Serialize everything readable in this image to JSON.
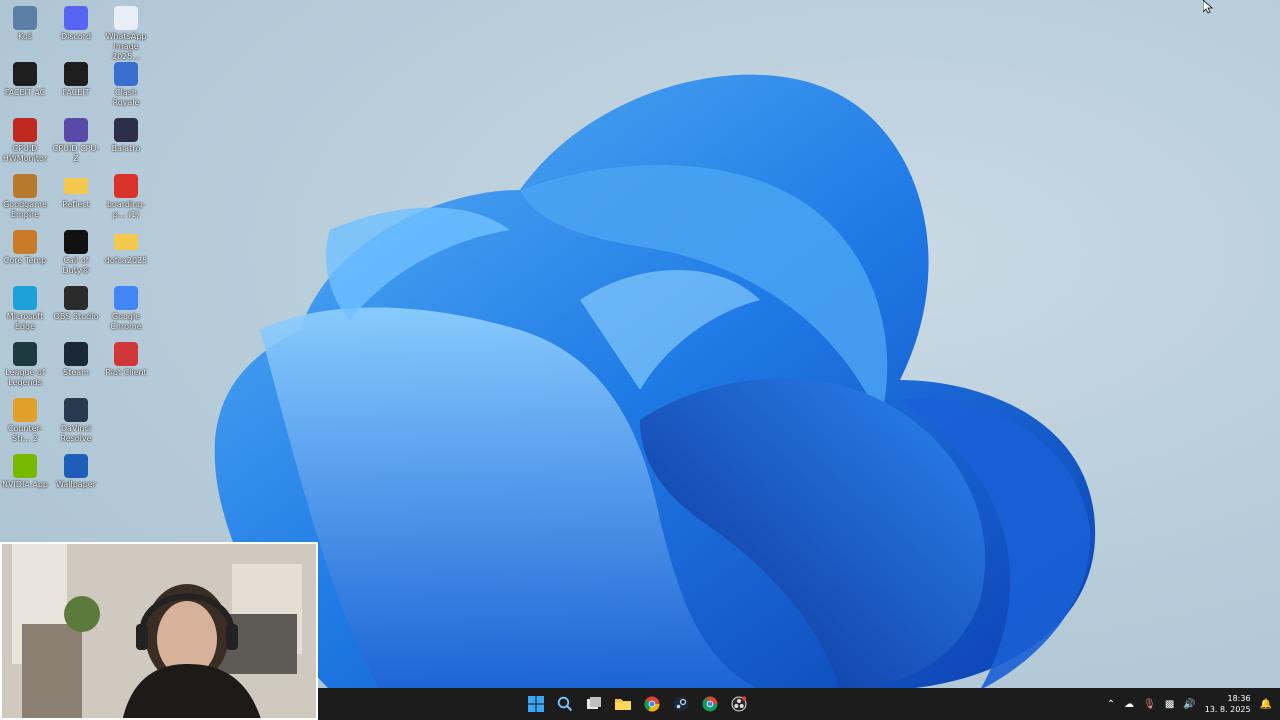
{
  "desktop": {
    "icons": [
      {
        "label": "Koš",
        "icon": "recycle-bin-icon",
        "color": "#5b7fa6"
      },
      {
        "label": "Discord",
        "icon": "discord-icon",
        "color": "#5865f2"
      },
      {
        "label": "WhatsApp Image 2025...",
        "icon": "image-file-icon",
        "color": "#e8eef5"
      },
      {
        "label": "FACEIT AC",
        "icon": "faceit-ac-icon",
        "color": "#1e1e1e"
      },
      {
        "label": "FACEIT",
        "icon": "faceit-icon",
        "color": "#1e1e1e"
      },
      {
        "label": "Clash Royale",
        "icon": "clash-royale-icon",
        "color": "#3a6fd0"
      },
      {
        "label": "CPUID HWMonitor",
        "icon": "hwmonitor-icon",
        "color": "#c0281f"
      },
      {
        "label": "CPUID CPU-Z",
        "icon": "cpu-z-icon",
        "color": "#5a4aa8"
      },
      {
        "label": "Balatro",
        "icon": "balatro-icon",
        "color": "#2b2f4a"
      },
      {
        "label": "Goodgame Empire",
        "icon": "goodgame-empire-icon",
        "color": "#b7792e"
      },
      {
        "label": "Reflect",
        "icon": "folder-icon",
        "color": "#f2c94c"
      },
      {
        "label": "boarding-p... (1)",
        "icon": "pdf-icon",
        "color": "#d9322b"
      },
      {
        "label": "Core Temp",
        "icon": "core-temp-icon",
        "color": "#c97b2a"
      },
      {
        "label": "Call of Duty®",
        "icon": "call-of-duty-icon",
        "color": "#111111"
      },
      {
        "label": "dofca2025",
        "icon": "folder-icon",
        "color": "#f2c94c"
      },
      {
        "label": "Microsoft Edge",
        "icon": "edge-icon",
        "color": "#1ea0d8"
      },
      {
        "label": "OBS Studio",
        "icon": "obs-icon",
        "color": "#2b2b2b"
      },
      {
        "label": "Google Chrome",
        "icon": "chrome-icon",
        "color": "#4285f4"
      },
      {
        "label": "League of Legends",
        "icon": "league-icon",
        "color": "#1c3a3f"
      },
      {
        "label": "Steam",
        "icon": "steam-icon",
        "color": "#1b2838"
      },
      {
        "label": "Riot Client",
        "icon": "riot-client-icon",
        "color": "#d13639"
      },
      {
        "label": "Counter-Str... 2",
        "icon": "cs2-icon",
        "color": "#e2a02b"
      },
      {
        "label": "DaVinci Resolve",
        "icon": "davinci-icon",
        "color": "#2a3a4e"
      },
      {
        "label": "NVIDIA App",
        "icon": "nvidia-icon",
        "color": "#76b900"
      },
      {
        "label": "Wallpaper",
        "icon": "wallpaper-engine-icon",
        "color": "#1d5fb8"
      }
    ]
  },
  "taskbar": {
    "apps": [
      {
        "name": "start-button",
        "icon": "windows-icon"
      },
      {
        "name": "search-button",
        "icon": "search-icon"
      },
      {
        "name": "task-view-button",
        "icon": "task-view-icon"
      },
      {
        "name": "file-explorer-button",
        "icon": "folder-icon"
      },
      {
        "name": "chrome-button",
        "icon": "chrome-icon"
      },
      {
        "name": "steam-button",
        "icon": "steam-icon"
      },
      {
        "name": "chrome-profile-button",
        "icon": "chrome-icon"
      },
      {
        "name": "obs-button",
        "icon": "obs-icon"
      }
    ],
    "clock": {
      "time": "18:36",
      "date": "13. 8. 2025"
    }
  },
  "colors": {
    "taskbar_bg": "#1c1c1c",
    "accent": "#1a6fe0"
  }
}
